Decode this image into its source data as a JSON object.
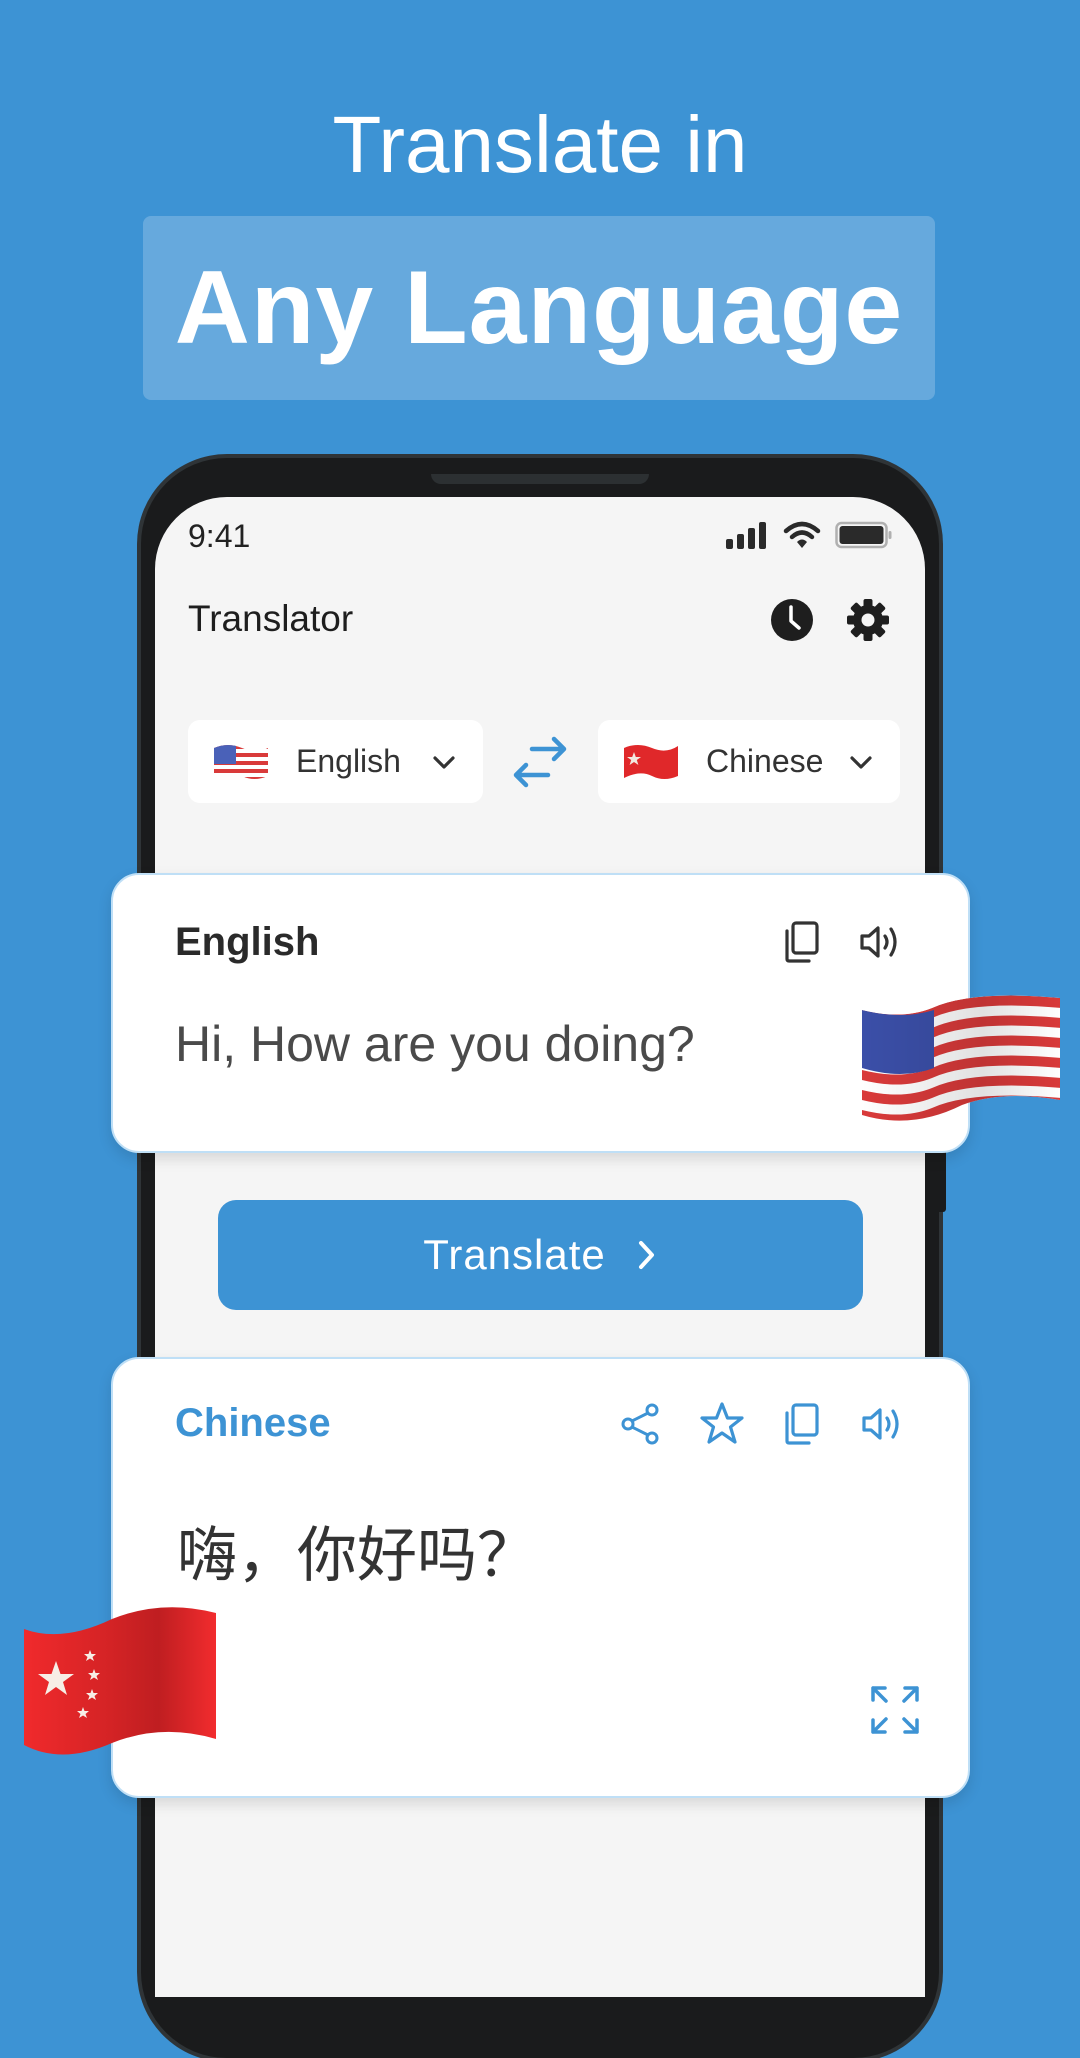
{
  "promo": {
    "headline_line1": "Translate in",
    "headline_line2": "Any Language"
  },
  "status_bar": {
    "time": "9:41",
    "icons": [
      "signal-icon",
      "wifi-icon",
      "battery-icon"
    ]
  },
  "app_bar": {
    "title": "Translator",
    "actions": [
      {
        "name": "history",
        "icon": "clock-icon"
      },
      {
        "name": "settings",
        "icon": "gear-icon"
      }
    ]
  },
  "language_selector": {
    "source": {
      "label": "English",
      "flag": "us-flag"
    },
    "target": {
      "label": "Chinese",
      "flag": "china-flag"
    },
    "swap_icon": "swap-arrows-icon"
  },
  "source_card": {
    "language": "English",
    "text": "Hi, How are you doing?",
    "actions": [
      "copy-icon",
      "speaker-icon"
    ]
  },
  "translate_button": {
    "label": "Translate",
    "icon": "chevron-right-icon"
  },
  "result_card": {
    "language": "Chinese",
    "text": "嗨，你好吗？",
    "actions": [
      "share-icon",
      "star-icon",
      "copy-icon",
      "speaker-icon"
    ],
    "expand_icon": "expand-icon"
  },
  "colors": {
    "background": "#3d93d4",
    "highlight_box": "#66a9dd",
    "accent": "#3d93d4",
    "text_dark": "#1e1e1e",
    "screen_bg": "#f5f5f5"
  }
}
